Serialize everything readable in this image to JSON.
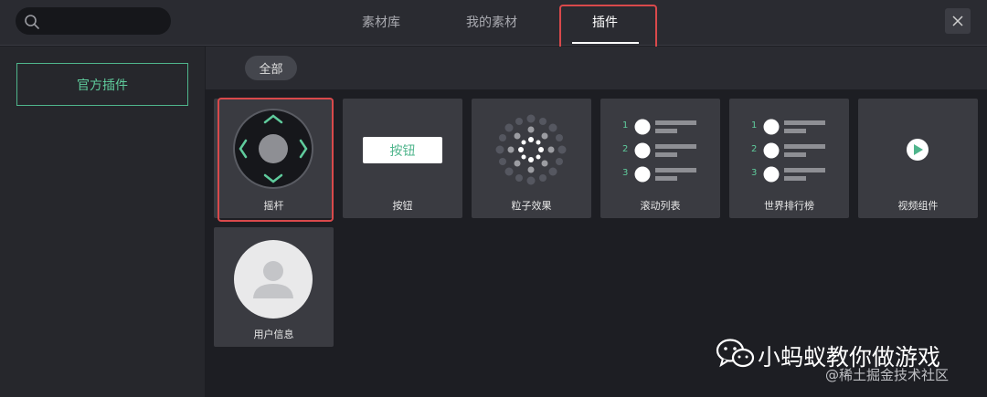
{
  "search": {
    "placeholder": ""
  },
  "tabs": [
    {
      "label": "素材库",
      "active": false
    },
    {
      "label": "我的素材",
      "active": false
    },
    {
      "label": "插件",
      "active": true
    }
  ],
  "sidebar": {
    "items": [
      {
        "label": "官方插件",
        "selected": true
      }
    ]
  },
  "filter": {
    "chips": [
      {
        "label": "全部",
        "selected": true
      }
    ]
  },
  "plugins": [
    {
      "label": "摇杆",
      "icon": "joystick-icon",
      "highlighted": true
    },
    {
      "label": "按钮",
      "icon": "button-preview-icon",
      "button_text": "按钮"
    },
    {
      "label": "粒子效果",
      "icon": "particles-icon"
    },
    {
      "label": "滚动列表",
      "icon": "scroll-list-icon",
      "numbers": [
        "1",
        "2",
        "3"
      ]
    },
    {
      "label": "世界排行榜",
      "icon": "leaderboard-icon",
      "numbers": [
        "1",
        "2",
        "3"
      ]
    },
    {
      "label": "视频组件",
      "icon": "play-icon"
    },
    {
      "label": "用户信息",
      "icon": "user-avatar-icon"
    }
  ],
  "watermark": {
    "title": "小蚂蚁教你做游戏",
    "subtitle": "@稀土掘金技术社区"
  },
  "colors": {
    "accent": "#5fcb9c",
    "highlight": "#d9494b",
    "background": "#1d1e23",
    "card": "#3a3b41"
  }
}
